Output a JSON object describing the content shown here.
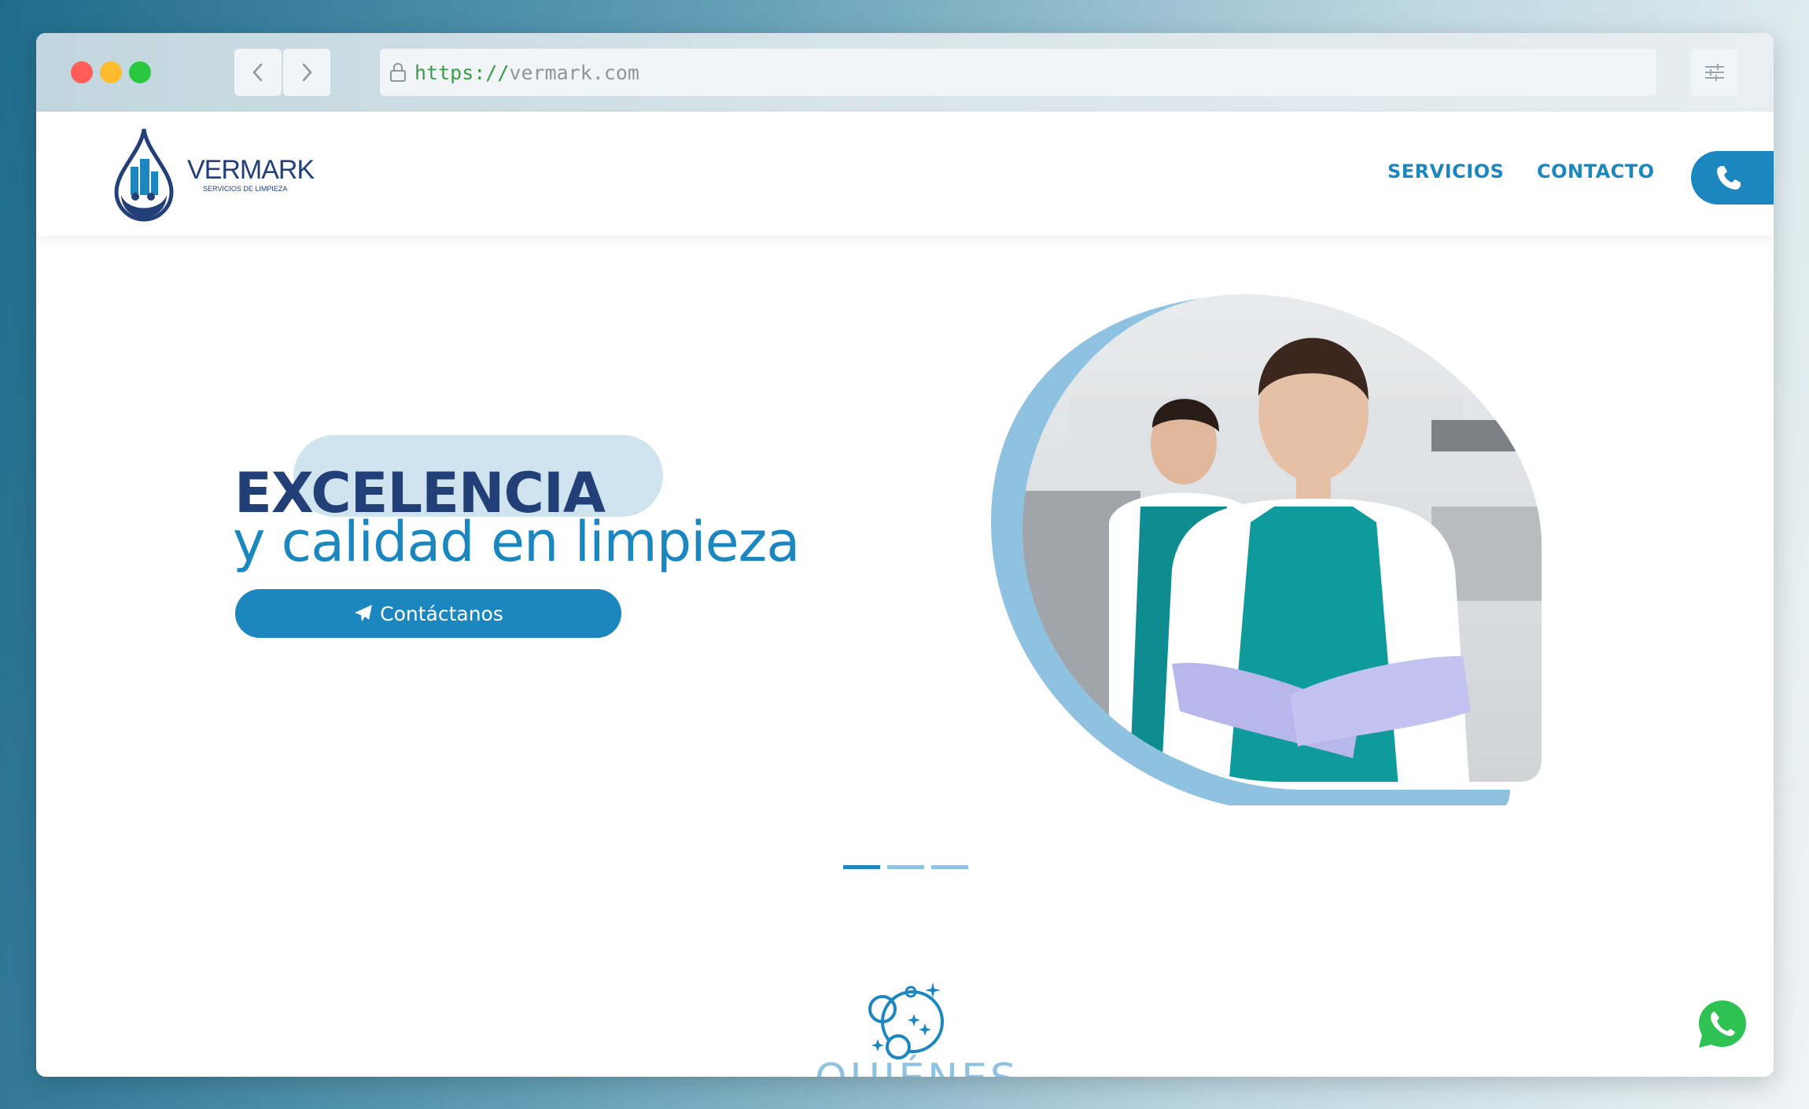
{
  "browser": {
    "url_scheme": "https://",
    "url_host": "vermark.com"
  },
  "header": {
    "logo_name": "VERMARK",
    "logo_tagline": "SERVICIOS DE LIMPIEZA",
    "menu": [
      {
        "label": "SERVICIOS"
      },
      {
        "label": "CONTACTO"
      }
    ],
    "phone_icon": "phone-icon"
  },
  "hero": {
    "title": "EXCELENCIA",
    "subtitle": "y calidad en limpieza",
    "cta_label": "Contáctanos",
    "cta_icon": "paper-plane-icon",
    "image": "woman-cleaner-photo",
    "slides": {
      "count": 3,
      "active": 1
    }
  },
  "about": {
    "icon": "bubbles-sparkle-icon",
    "title": "QUIÉNES"
  },
  "floating": {
    "whatsapp_icon": "whatsapp-icon"
  },
  "colors": {
    "primary": "#1c86bf",
    "navy": "#233f78",
    "light": "#8ec2e0",
    "pill_bg": "#cfe4ef"
  }
}
